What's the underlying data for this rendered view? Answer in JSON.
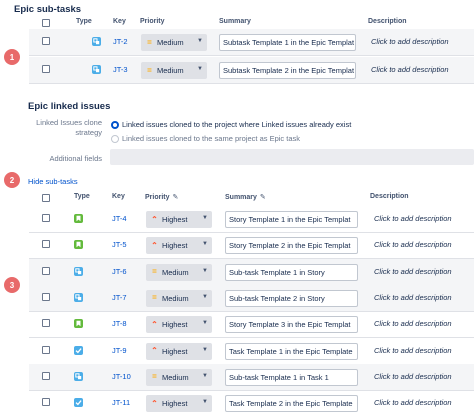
{
  "epic_subtasks": {
    "title": "Epic sub-tasks",
    "headers": {
      "type": "Type",
      "key": "Key",
      "priority": "Priority",
      "summary": "Summary",
      "description": "Description"
    },
    "rows": [
      {
        "key": "JT-2",
        "type": "subtask-icon",
        "priority": "Medium",
        "summary": "Subtask Template 1 in the Epic Templat",
        "description": "Click to add description"
      },
      {
        "key": "JT-3",
        "type": "subtask-icon",
        "priority": "Medium",
        "summary": "Subtask Template 2 in the Epic Templat",
        "description": "Click to add description"
      }
    ]
  },
  "epic_linked": {
    "title": "Epic linked issues",
    "strategy_label": "Linked Issues clone strategy",
    "option1": "Linked issues cloned to the project where Linked issues already exist",
    "option2": "Linked issues cloned to the same project as Epic task",
    "additional_fields_label": "Additional fields"
  },
  "hide_subtasks_link": "Hide sub-tasks",
  "linked_table": {
    "headers": {
      "type": "Type",
      "key": "Key",
      "priority": "Priority",
      "summary": "Summary",
      "description": "Description"
    },
    "rows": [
      {
        "key": "JT-4",
        "type": "story-icon",
        "priority": "Highest",
        "summary": "Story Template 1 in the Epic Templat",
        "description": "Click to add description",
        "sub": false
      },
      {
        "key": "JT-5",
        "type": "story-icon",
        "priority": "Highest",
        "summary": "Story Template 2 in the Epic Templat",
        "description": "Click to add description",
        "sub": false
      },
      {
        "key": "JT-6",
        "type": "subtask-icon",
        "priority": "Medium",
        "summary": "Sub-task Template 1 in Story",
        "description": "Click to add description",
        "sub": true
      },
      {
        "key": "JT-7",
        "type": "subtask-icon",
        "priority": "Medium",
        "summary": "Sub-task Template 2 in Story",
        "description": "Click to add description",
        "sub": true
      },
      {
        "key": "JT-8",
        "type": "story-icon",
        "priority": "Highest",
        "summary": "Story Template 3 in the Epic Templat",
        "description": "Click to add description",
        "sub": false
      },
      {
        "key": "JT-9",
        "type": "task-icon",
        "priority": "Highest",
        "summary": "Task Template 1 in the Epic Template",
        "description": "Click to add description",
        "sub": false
      },
      {
        "key": "JT-10",
        "type": "subtask-icon",
        "priority": "Medium",
        "summary": "Sub-task Template 1 in Task 1",
        "description": "Click to add description",
        "sub": true
      },
      {
        "key": "JT-11",
        "type": "task-icon",
        "priority": "Highest",
        "summary": "Task Template 2 in the Epic Template",
        "description": "Click to add description",
        "sub": false
      }
    ]
  },
  "badges": [
    "1",
    "2",
    "3"
  ],
  "colors": {
    "link": "#0052cc",
    "badge": "#e86a6a",
    "medium": "#ffab00",
    "highest": "#ff5630",
    "story": "#63ba3c",
    "subtask": "#4bade8"
  }
}
